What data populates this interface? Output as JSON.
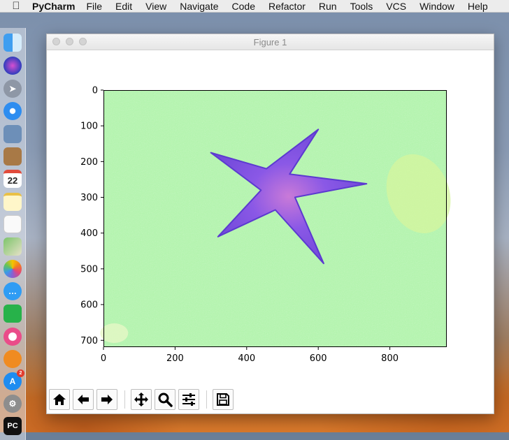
{
  "menubar": {
    "apple": "",
    "app_name": "PyCharm",
    "items": [
      "File",
      "Edit",
      "View",
      "Navigate",
      "Code",
      "Refactor",
      "Run",
      "Tools",
      "VCS",
      "Window",
      "Help"
    ]
  },
  "dock": {
    "icons": [
      "finder-icon",
      "siri-icon",
      "launchpad-icon",
      "safari-icon",
      "preview-icon",
      "notes-brown-icon",
      "calendar-icon",
      "notes-icon",
      "reminders-icon",
      "maps-icon",
      "photos-icon",
      "messages-icon",
      "facetime-icon",
      "itunes-icon",
      "ibooks-icon",
      "app-store-icon",
      "system-preferences-icon",
      "pycharm-icon"
    ],
    "calendar_day": "22",
    "app_store_badge": "2",
    "pycharm_label": "PC"
  },
  "window": {
    "title": "Figure 1"
  },
  "chart_data": {
    "type": "image",
    "title": "",
    "xlabel": "",
    "ylabel": "",
    "xlim": [
      0,
      959
    ],
    "ylim": [
      719,
      0
    ],
    "xticks": [
      0,
      200,
      400,
      600,
      800
    ],
    "yticks": [
      0,
      100,
      200,
      300,
      400,
      500,
      600,
      700
    ],
    "image_content": "purple starfish on light green background",
    "colors": {
      "background": "#aef3a8",
      "starfish": "#7b4fe0",
      "starfish_center": "#c26bd6"
    }
  },
  "toolbar": {
    "buttons": [
      "home",
      "back",
      "forward",
      "pan",
      "zoom",
      "configure-subplots",
      "save"
    ]
  }
}
